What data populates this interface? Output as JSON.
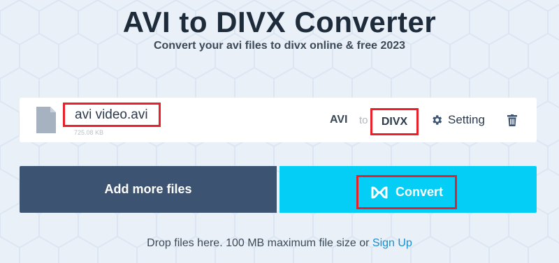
{
  "header": {
    "title": "AVI to DIVX Converter",
    "subtitle": "Convert your avi files to divx online & free 2023"
  },
  "file": {
    "name": "avi video.avi",
    "size": "725.08 KB",
    "from_format": "AVI",
    "to_word": "to",
    "to_format": "DIVX",
    "setting_label": "Setting",
    "file_icon": "file-icon",
    "setting_icon": "gear-icon",
    "delete_icon": "trash-icon"
  },
  "actions": {
    "add_label": "Add more files",
    "convert_label": "Convert",
    "convert_icon": "convert-logo-icon"
  },
  "footer": {
    "text": "Drop files here. 100 MB maximum file size or",
    "link": "Sign Up"
  },
  "colors": {
    "background": "#e9f0f8",
    "add_button": "#3c5471",
    "convert_button": "#04cdf6",
    "highlight": "#e8202a",
    "link": "#1a8fd0"
  }
}
